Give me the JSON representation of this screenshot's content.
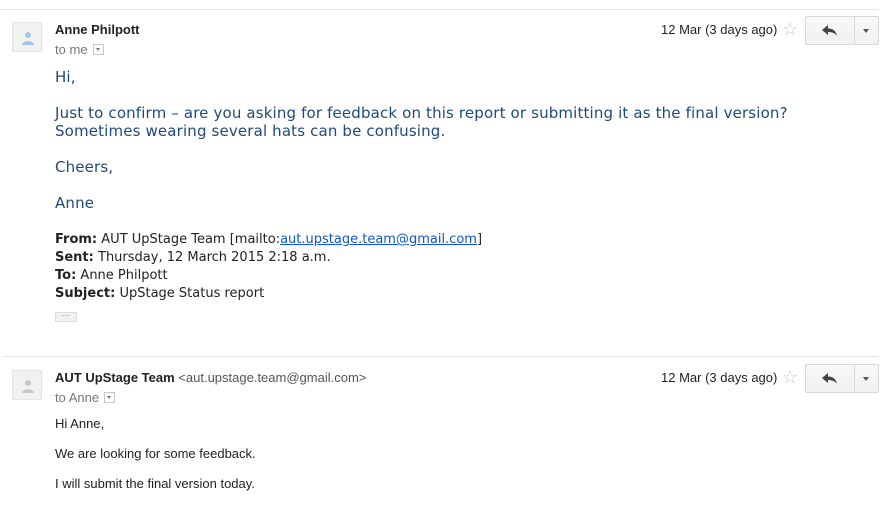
{
  "messages": [
    {
      "sender_name": "Anne Philpott",
      "sender_email": "",
      "recipient": "to me",
      "date": "12 Mar (3 days ago)",
      "body": [
        "Hi,",
        "Just to confirm – are you asking for feedback on this report or submitting it as the final version? Sometimes wearing several hats can be confusing.",
        "Cheers,",
        "Anne"
      ],
      "quoted": {
        "from_label": "From:",
        "from_value": "AUT UpStage Team [mailto:",
        "from_link": "aut.upstage.team@gmail.com",
        "from_close": "]",
        "sent_label": "Sent:",
        "sent_value": "Thursday, 12 March 2015 2:18 a.m.",
        "to_label": "To:",
        "to_value": "Anne Philpott",
        "subject_label": "Subject:",
        "subject_value": "UpStage Status report"
      },
      "ellipsis": "···"
    },
    {
      "sender_name": "AUT UpStage Team",
      "sender_email": "<aut.upstage.team@gmail.com>",
      "recipient": "to Anne",
      "date": "12 Mar (3 days ago)",
      "body": [
        "Hi Anne,",
        "We are looking for some feedback.",
        "I will submit the final version today."
      ]
    }
  ],
  "icons": {
    "avatar": "person-icon",
    "star": "star-icon",
    "reply": "reply-icon",
    "more": "chevron-down-icon"
  },
  "colors": {
    "quoted_text": "#1f497d",
    "link": "#1155cc"
  }
}
